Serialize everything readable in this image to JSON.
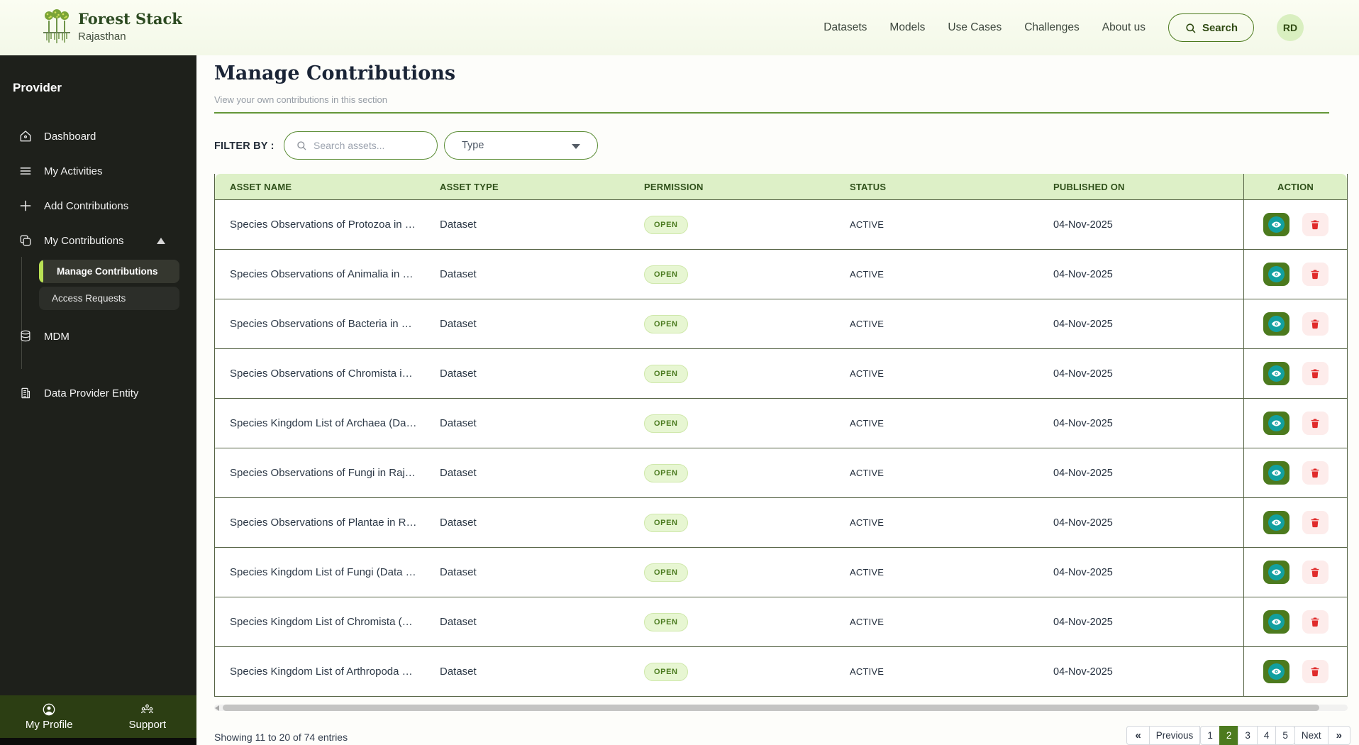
{
  "brand": {
    "name": "Forest Stack",
    "region": "Rajasthan"
  },
  "topnav": {
    "items": [
      "Datasets",
      "Models",
      "Use Cases",
      "Challenges",
      "About us"
    ],
    "search_label": "Search",
    "avatar_initials": "RD"
  },
  "sidebar": {
    "role_label": "Provider",
    "items": {
      "dashboard": "Dashboard",
      "my_activities": "My Activities",
      "add_contributions": "Add Contributions",
      "my_contributions": "My Contributions",
      "manage_contributions": "Manage Contributions",
      "access_requests": "Access Requests",
      "mdm": "MDM",
      "data_provider_entity": "Data Provider Entity"
    },
    "footer": {
      "my_profile": "My Profile",
      "support": "Support"
    }
  },
  "page": {
    "title": "Manage Contributions",
    "subtitle": "View your own contributions in this section",
    "filter_label": "FILTER BY :",
    "search_placeholder": "Search assets...",
    "type_label": "Type"
  },
  "table": {
    "columns": [
      "ASSET NAME",
      "ASSET TYPE",
      "PERMISSION",
      "STATUS",
      "PUBLISHED ON",
      "ACTION"
    ],
    "rows": [
      {
        "name": "Species Observations of Protozoa in …",
        "type": "Dataset",
        "permission": "OPEN",
        "status": "ACTIVE",
        "published_on": "04-Nov-2025"
      },
      {
        "name": "Species Observations of Animalia in …",
        "type": "Dataset",
        "permission": "OPEN",
        "status": "ACTIVE",
        "published_on": "04-Nov-2025"
      },
      {
        "name": "Species Observations of Bacteria in …",
        "type": "Dataset",
        "permission": "OPEN",
        "status": "ACTIVE",
        "published_on": "04-Nov-2025"
      },
      {
        "name": "Species Observations of Chromista i…",
        "type": "Dataset",
        "permission": "OPEN",
        "status": "ACTIVE",
        "published_on": "04-Nov-2025"
      },
      {
        "name": "Species Kingdom List of Archaea (Da…",
        "type": "Dataset",
        "permission": "OPEN",
        "status": "ACTIVE",
        "published_on": "04-Nov-2025"
      },
      {
        "name": "Species Observations of Fungi in Raj…",
        "type": "Dataset",
        "permission": "OPEN",
        "status": "ACTIVE",
        "published_on": "04-Nov-2025"
      },
      {
        "name": "Species Observations of Plantae in R…",
        "type": "Dataset",
        "permission": "OPEN",
        "status": "ACTIVE",
        "published_on": "04-Nov-2025"
      },
      {
        "name": "Species Kingdom List of Fungi (Data …",
        "type": "Dataset",
        "permission": "OPEN",
        "status": "ACTIVE",
        "published_on": "04-Nov-2025"
      },
      {
        "name": "Species Kingdom List of Chromista (…",
        "type": "Dataset",
        "permission": "OPEN",
        "status": "ACTIVE",
        "published_on": "04-Nov-2025"
      },
      {
        "name": "Species Kingdom List of Arthropoda …",
        "type": "Dataset",
        "permission": "OPEN",
        "status": "ACTIVE",
        "published_on": "04-Nov-2025"
      }
    ]
  },
  "pagination": {
    "summary": "Showing 11 to 20 of 74 entries",
    "first": "«",
    "prev": "Previous",
    "pages": [
      "1",
      "2",
      "3",
      "4",
      "5"
    ],
    "active_page": "2",
    "next": "Next",
    "last": "»"
  },
  "colors": {
    "accent_green": "#4c7a1e",
    "lime": "#b9e154",
    "table_head_bg": "#ddf0c7",
    "badge_bg": "#e7f6d2",
    "badge_text": "#4a7a1e",
    "danger_red": "#e02b2b",
    "danger_bg": "#fdeceb",
    "sidebar_bg": "#1e201b",
    "sidebar_footer_bg": "#2c3e13",
    "border_olive": "#556344",
    "teal": "#12a0a0"
  }
}
